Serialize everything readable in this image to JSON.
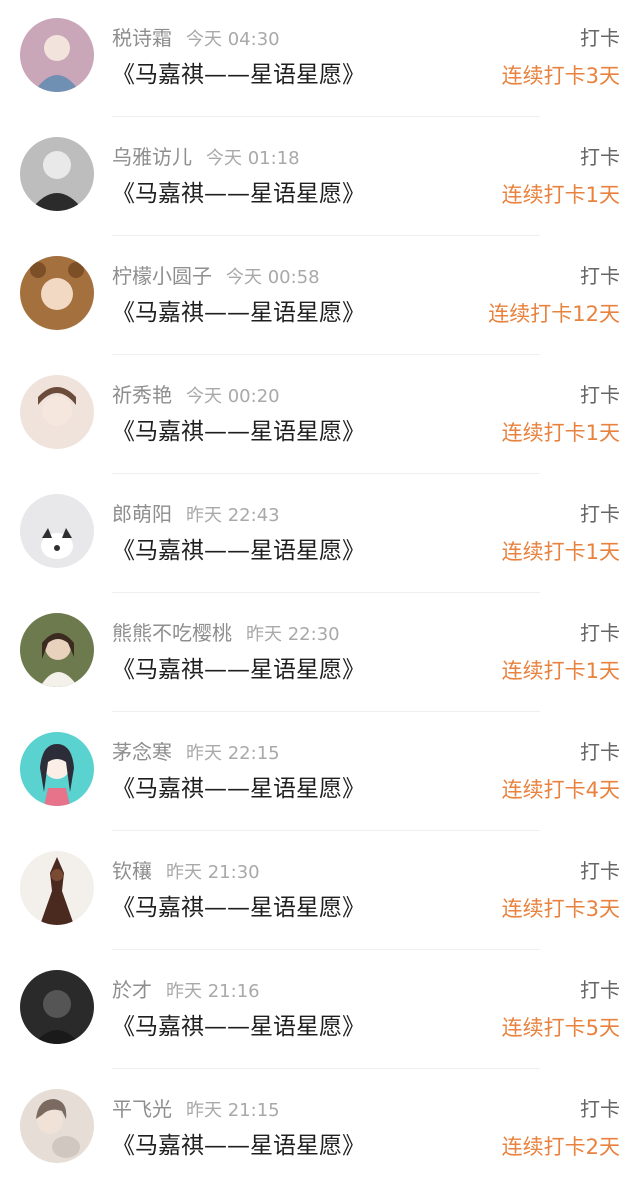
{
  "feed": {
    "items": [
      {
        "username": "税诗霜",
        "time": "今天 04:30",
        "book": "《马嘉祺——星语星愿》",
        "action": "打卡",
        "streak": "连续打卡3天",
        "avatar_color": "#c9a7b8",
        "avatar_accent": "#6f8fb3"
      },
      {
        "username": "乌雅访儿",
        "time": "今天 01:18",
        "book": "《马嘉祺——星语星愿》",
        "action": "打卡",
        "streak": "连续打卡1天",
        "avatar_color": "#bdbdbd",
        "avatar_accent": "#2b2b2b"
      },
      {
        "username": "柠檬小圆子",
        "time": "今天 00:58",
        "book": "《马嘉祺——星语星愿》",
        "action": "打卡",
        "streak": "连续打卡12天",
        "avatar_color": "#a3703e",
        "avatar_accent": "#f1d9c3"
      },
      {
        "username": "祈秀艳",
        "time": "今天 00:20",
        "book": "《马嘉祺——星语星愿》",
        "action": "打卡",
        "streak": "连续打卡1天",
        "avatar_color": "#efe3dc",
        "avatar_accent": "#6b4c3b"
      },
      {
        "username": "郎萌阳",
        "time": "昨天 22:43",
        "book": "《马嘉祺——星语星愿》",
        "action": "打卡",
        "streak": "连续打卡1天",
        "avatar_color": "#e8e8ea",
        "avatar_accent": "#2f2f2f"
      },
      {
        "username": "熊熊不吃樱桃",
        "time": "昨天 22:30",
        "book": "《马嘉祺——星语星愿》",
        "action": "打卡",
        "streak": "连续打卡1天",
        "avatar_color": "#6d7a4e",
        "avatar_accent": "#e8d2bd"
      },
      {
        "username": "茅念寒",
        "time": "昨天 22:15",
        "book": "《马嘉祺——星语星愿》",
        "action": "打卡",
        "streak": "连续打卡4天",
        "avatar_color": "#59d2d0",
        "avatar_accent": "#2d2d3a"
      },
      {
        "username": "钦穰",
        "time": "昨天 21:30",
        "book": "《马嘉祺——星语星愿》",
        "action": "打卡",
        "streak": "连续打卡3天",
        "avatar_color": "#f3f0ec",
        "avatar_accent": "#4a2a1f"
      },
      {
        "username": "於才",
        "time": "昨天 21:16",
        "book": "《马嘉祺——星语星愿》",
        "action": "打卡",
        "streak": "连续打卡5天",
        "avatar_color": "#2a2a2a",
        "avatar_accent": "#555555"
      },
      {
        "username": "平飞光",
        "time": "昨天 21:15",
        "book": "《马嘉祺——星语星愿》",
        "action": "打卡",
        "streak": "连续打卡2天",
        "avatar_color": "#e5ddd6",
        "avatar_accent": "#7a6a60"
      }
    ]
  },
  "colors": {
    "streak": "#e8823f",
    "username": "#8e8e8e",
    "time": "#a9a9a9",
    "action": "#666666",
    "book": "#1f1f1f"
  }
}
